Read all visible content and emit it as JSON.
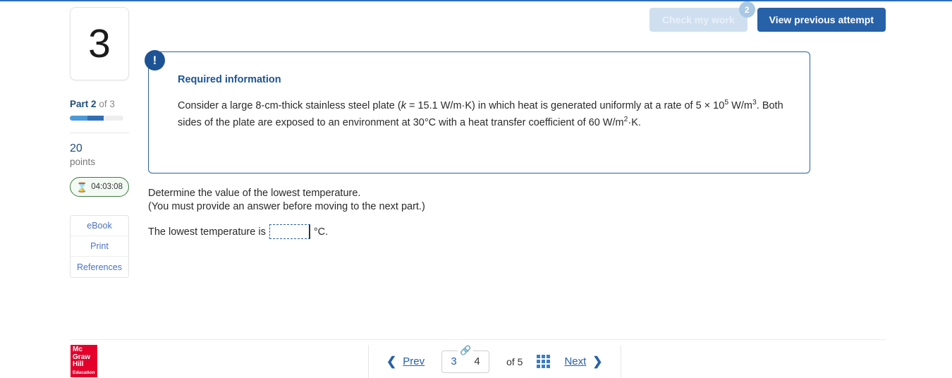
{
  "header": {
    "check_my_work_label": "Check my work",
    "check_my_work_badge": "2",
    "view_previous_attempt_label": "View previous attempt"
  },
  "sidebar": {
    "question_number": "3",
    "part_prefix": "Part",
    "part_current": "2",
    "part_of": "of 3",
    "points_value": "20",
    "points_label": "points",
    "timer_icon": "hourglass-icon",
    "timer_value": "04:03:08",
    "tools": [
      {
        "label": "eBook",
        "name": "ebook-button"
      },
      {
        "label": "Print",
        "name": "print-button"
      },
      {
        "label": "References",
        "name": "references-button"
      }
    ]
  },
  "info_box": {
    "icon": "exclamation-icon",
    "title": "Required information",
    "text_part1": "Consider a large 8-cm-thick stainless steel plate (",
    "k_symbol": "k",
    "text_part2": " = 15.1 W/m·K) in which heat is generated uniformly at a rate of 5 × 10",
    "sup1": "5",
    "text_part3": " W/m",
    "sup2": "3",
    "text_part4": ". Both sides of the plate are exposed to an environment at 30°C with a heat transfer coefficient of 60 W/m",
    "sup3": "2",
    "text_part5": "·K."
  },
  "prompt": {
    "line1": "Determine the value of the lowest temperature.",
    "line2": "(You must provide an answer before moving to the next part.)"
  },
  "answer": {
    "prefix": "The lowest temperature is",
    "value": "",
    "placeholder": "",
    "unit": "°C."
  },
  "footer": {
    "logo_line1": "Mc",
    "logo_line2": "Graw",
    "logo_line3": "Hill",
    "logo_line4": "Education",
    "prev_label": "Prev",
    "next_label": "Next",
    "page_current": "3",
    "page_next": "4",
    "page_total": "of 5",
    "link_icon": "link-icon",
    "grid_icon": "grid-icon"
  },
  "colors": {
    "accent_blue": "#2761a8",
    "dark_blue": "#1d5395",
    "timer_green": "#3f7a3f",
    "logo_red": "#e4002b"
  }
}
